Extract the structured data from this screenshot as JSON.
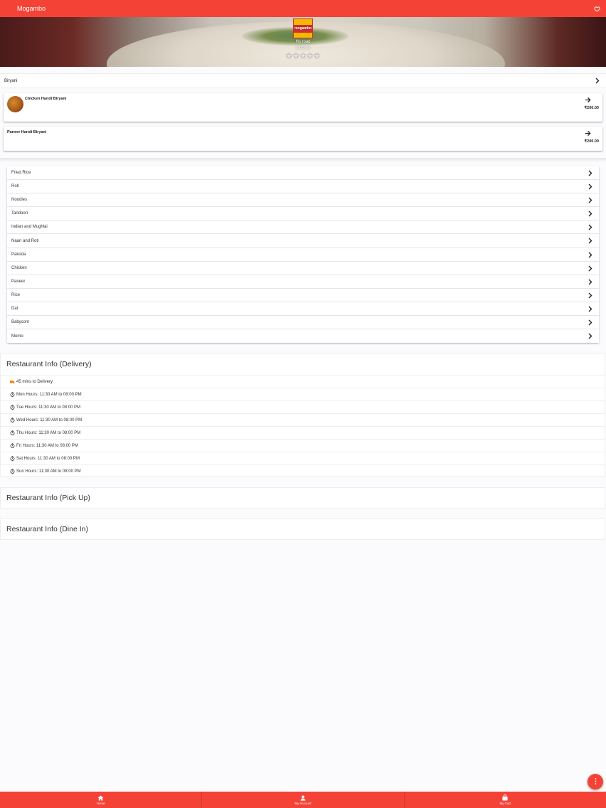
{
  "app": {
    "title": "Mogambo"
  },
  "hero": {
    "logo_text": "mogambo",
    "location": "Hs road",
    "distance": "0.00 mi",
    "rating_stars": "★★★★★",
    "rating": 0
  },
  "category": {
    "title": "Biryani",
    "dishes": [
      {
        "name": "Chicken Handi Biryani",
        "price": "₹200.00",
        "has_image": true
      },
      {
        "name": "Paneer Handi Biryani",
        "price": "₹200.00",
        "has_image": false
      }
    ]
  },
  "categories": [
    {
      "label": "Fried Rice"
    },
    {
      "label": "Roll"
    },
    {
      "label": "Noodles"
    },
    {
      "label": "Tandoori"
    },
    {
      "label": "Indian and Mughlai"
    },
    {
      "label": "Naan and Roti"
    },
    {
      "label": "Pakoda"
    },
    {
      "label": "Chicken"
    },
    {
      "label": "Paneer"
    },
    {
      "label": "Rice"
    },
    {
      "label": "Dal"
    },
    {
      "label": "Babycorn"
    },
    {
      "label": "Momo"
    }
  ],
  "delivery_info": {
    "title": "Restaurant Info (Delivery)",
    "delivery_time": "45 mins to Delivery",
    "hours": [
      "Mon Hours: 11:30 AM to 08:00 PM",
      "Tue Hours: 11:30 AM to 08:00 PM",
      "Wed Hours: 11:30 AM to 08:00 PM",
      "Thu Hours: 11:30 AM to 08:00 PM",
      "Fri Hours: 11:30 AM to 08:00 PM",
      "Sat Hours: 11:30 AM to 08:00 PM",
      "Sun Hours: 11:30 AM to 08:00 PM"
    ]
  },
  "pickup_info": {
    "title": "Restaurant Info (Pick Up)"
  },
  "dinein_info": {
    "title": "Restaurant Info (Dine In)"
  },
  "bottom_nav": [
    {
      "label": "Home",
      "icon": "home-icon"
    },
    {
      "label": "My Account",
      "icon": "person-icon"
    },
    {
      "label": "My Cart",
      "icon": "bag-icon"
    }
  ],
  "colors": {
    "primary": "#f44336",
    "delivery_icon": "#ff7a00"
  }
}
